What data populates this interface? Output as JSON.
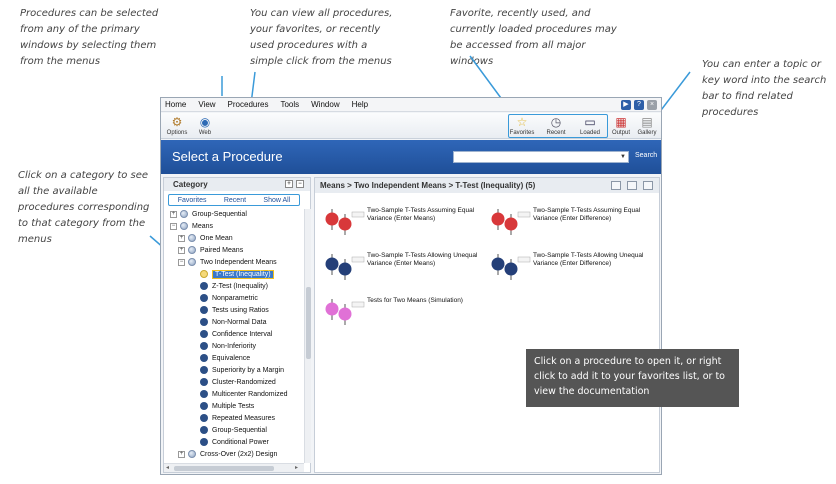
{
  "annotations": {
    "menus_note": "Procedures can be selected from any of the primary windows by selecting them from the menus",
    "favorites_note": "You can view all procedures, your favorites, or recently used procedures with a simple click from the menus",
    "loaded_note": "Favorite, recently used, and currently loaded procedures may be accessed from all major windows",
    "search_note": "You can enter a topic or key word into the search bar to find related procedures",
    "category_note": "Click on a category to see all the available procedures corresponding to that category from the menus",
    "tooltip_note": "Click on a procedure to open it, or right click to add it to your favorites list, or to view the documentation"
  },
  "menubar": [
    "Home",
    "View",
    "Procedures",
    "Tools",
    "Window",
    "Help"
  ],
  "toolbar": {
    "options": "Options",
    "web": "Web",
    "favorites": "Favorites",
    "recent": "Recent",
    "loaded": "Loaded",
    "output": "Output",
    "gallery": "Gallery"
  },
  "banner": {
    "title": "Select a Procedure",
    "search_placeholder": "",
    "search_button": "Search"
  },
  "category": {
    "header": "Category",
    "tabs": [
      "Favorites",
      "Recent",
      "Show All"
    ],
    "tree": [
      {
        "label": "Group-Sequential",
        "level": 0,
        "expander": "+",
        "kind": "folder"
      },
      {
        "label": "Means",
        "level": 0,
        "expander": "−",
        "kind": "folder"
      },
      {
        "label": "One Mean",
        "level": 1,
        "expander": "+",
        "kind": "folder"
      },
      {
        "label": "Paired Means",
        "level": 1,
        "expander": "+",
        "kind": "folder"
      },
      {
        "label": "Two Independent Means",
        "level": 1,
        "expander": "−",
        "kind": "folder"
      },
      {
        "label": "T-Test (Inequality)",
        "level": 2,
        "expander": "",
        "kind": "selected"
      },
      {
        "label": "Z-Test (Inequality)",
        "level": 2,
        "expander": "",
        "kind": "item"
      },
      {
        "label": "Nonparametric",
        "level": 2,
        "expander": "",
        "kind": "item"
      },
      {
        "label": "Tests using Ratios",
        "level": 2,
        "expander": "",
        "kind": "item"
      },
      {
        "label": "Non-Normal Data",
        "level": 2,
        "expander": "",
        "kind": "item"
      },
      {
        "label": "Confidence Interval",
        "level": 2,
        "expander": "",
        "kind": "item"
      },
      {
        "label": "Non-Inferiority",
        "level": 2,
        "expander": "",
        "kind": "item"
      },
      {
        "label": "Equivalence",
        "level": 2,
        "expander": "",
        "kind": "item"
      },
      {
        "label": "Superiority by a Margin",
        "level": 2,
        "expander": "",
        "kind": "item"
      },
      {
        "label": "Cluster-Randomized",
        "level": 2,
        "expander": "",
        "kind": "item"
      },
      {
        "label": "Multicenter Randomized",
        "level": 2,
        "expander": "",
        "kind": "item"
      },
      {
        "label": "Multiple Tests",
        "level": 2,
        "expander": "",
        "kind": "item"
      },
      {
        "label": "Repeated Measures",
        "level": 2,
        "expander": "",
        "kind": "item"
      },
      {
        "label": "Group-Sequential",
        "level": 2,
        "expander": "",
        "kind": "item"
      },
      {
        "label": "Conditional Power",
        "level": 2,
        "expander": "",
        "kind": "item"
      },
      {
        "label": "Cross-Over (2x2) Design",
        "level": 1,
        "expander": "+",
        "kind": "folder"
      }
    ]
  },
  "main": {
    "breadcrumb": "Means > Two Independent Means > T-Test (Inequality) (5)",
    "procedures": [
      {
        "label": "Two-Sample T-Tests Assuming Equal Variance (Enter Means)",
        "color": "#d8383a"
      },
      {
        "label": "Two-Sample T-Tests Assuming Equal Variance (Enter Difference)",
        "color": "#d8383a"
      },
      {
        "label": "Two-Sample T-Tests Allowing Unequal Variance (Enter Means)",
        "color": "#243f78"
      },
      {
        "label": "Two-Sample T-Tests Allowing Unequal Variance (Enter Difference)",
        "color": "#243f78"
      },
      {
        "label": "Tests for Two Means (Simulation)",
        "color": "#e071d6"
      }
    ]
  },
  "colors": {
    "banner": "#2a5ead",
    "accent_box": "#3a9ad9",
    "tooltip_bg": "#555555"
  }
}
